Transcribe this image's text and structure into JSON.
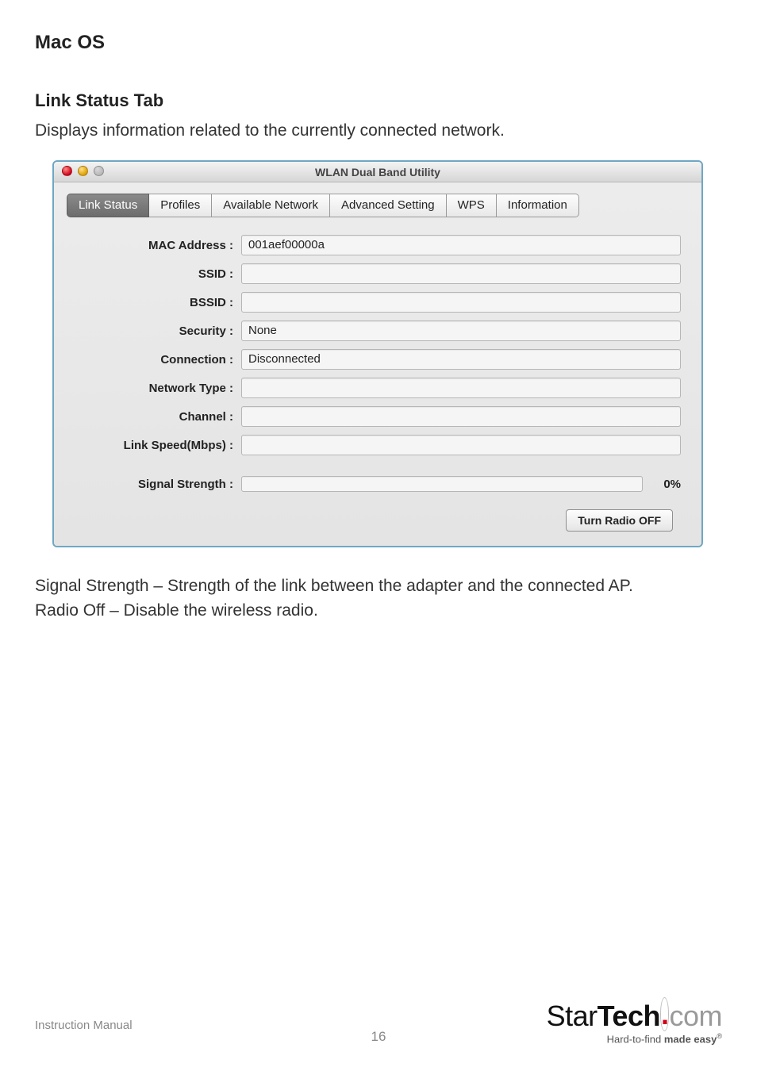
{
  "headings": {
    "macos": "Mac OS",
    "link_status_tab": "Link Status Tab"
  },
  "paragraphs": {
    "intro": "Displays information related to the currently connected network.",
    "sig_desc": "Signal Strength – Strength of the link between the adapter and the connected AP.",
    "radio_desc": "Radio Off – Disable the wireless radio."
  },
  "window": {
    "title": "WLAN Dual Band Utility",
    "tabs": {
      "link_status": "Link Status",
      "profiles": "Profiles",
      "available_network": "Available Network",
      "advanced_setting": "Advanced Setting",
      "wps": "WPS",
      "information": "Information"
    },
    "fields": {
      "mac_label": "MAC Address :",
      "mac_value": "001aef00000a",
      "ssid_label": "SSID :",
      "ssid_value": "",
      "bssid_label": "BSSID :",
      "bssid_value": "",
      "security_label": "Security :",
      "security_value": "None",
      "connection_label": "Connection :",
      "connection_value": "Disconnected",
      "nettype_label": "Network Type :",
      "nettype_value": "",
      "channel_label": "Channel :",
      "channel_value": "",
      "linkspeed_label": "Link Speed(Mbps) :",
      "linkspeed_value": "",
      "signal_label": "Signal Strength :",
      "signal_pct": "0%"
    },
    "buttons": {
      "turn_radio_off": "Turn Radio OFF"
    }
  },
  "footer": {
    "instruction_manual": "Instruction Manual",
    "page_number": "16",
    "brand_star": "Star",
    "brand_tech": "Tech",
    "brand_com": "com",
    "tagline_prefix": "Hard-to-find ",
    "tagline_easy": "made easy",
    "tagline_reg": "®"
  }
}
